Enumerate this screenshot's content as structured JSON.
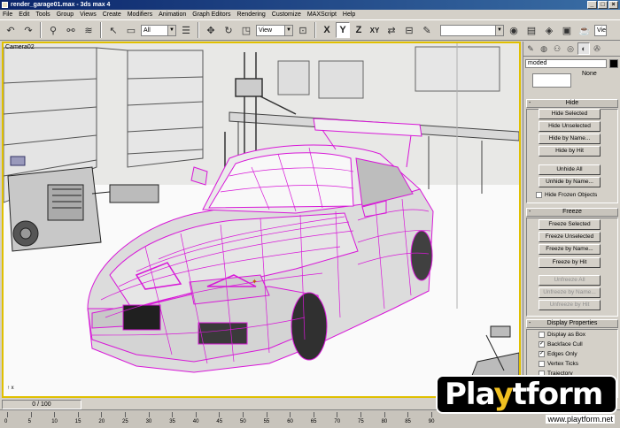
{
  "window": {
    "title": "render_garage01.max - 3ds max 4",
    "buttons": [
      "_",
      "□",
      "×"
    ]
  },
  "menu": [
    "File",
    "Edit",
    "Tools",
    "Group",
    "Views",
    "Create",
    "Modifiers",
    "Animation",
    "Graph Editors",
    "Rendering",
    "Customize",
    "MAXScript",
    "Help"
  ],
  "toolbar": {
    "selection_filter": "All",
    "reference_coord": "View",
    "axis_buttons": [
      "X",
      "Y",
      "Z",
      "XY"
    ],
    "viewport_menu": "Vie"
  },
  "viewport": {
    "label": "Camera02",
    "wire_color": "#e020e0",
    "border_color": "#e0c000"
  },
  "command_panel": {
    "object_name": "moded",
    "none_label": "None",
    "hide": {
      "title": "Hide",
      "buttons": [
        "Hide Selected",
        "Hide Unselected",
        "Hide by Name...",
        "Hide by Hit",
        "Unhide All",
        "Unhide by Name..."
      ],
      "checkbox": "Hide Frozen Objects"
    },
    "freeze": {
      "title": "Freeze",
      "buttons": [
        "Freeze Selected",
        "Freeze Unselected",
        "Freeze by Name...",
        "Freeze by Hit"
      ],
      "disabled_buttons": [
        "Unfreeze All",
        "Unfreeze by Name...",
        "Unfreeze by Hit"
      ]
    },
    "display_properties": {
      "title": "Display Properties",
      "options": [
        {
          "label": "Display as Box",
          "checked": false
        },
        {
          "label": "Backface Cull",
          "checked": true
        },
        {
          "label": "Edges Only",
          "checked": true
        },
        {
          "label": "Vertex Ticks",
          "checked": false
        },
        {
          "label": "Trajectory",
          "checked": false
        }
      ]
    }
  },
  "timeline": {
    "slider": "0 / 100",
    "ticks": [
      "0",
      "5",
      "10",
      "15",
      "20",
      "25",
      "30",
      "35",
      "40",
      "45",
      "50",
      "55",
      "60",
      "65",
      "70",
      "75",
      "80",
      "85",
      "90"
    ]
  },
  "watermark": {
    "logo_pre": "Pla",
    "logo_accent": "y",
    "logo_post": "tform",
    "url": "www.playtform.net"
  }
}
